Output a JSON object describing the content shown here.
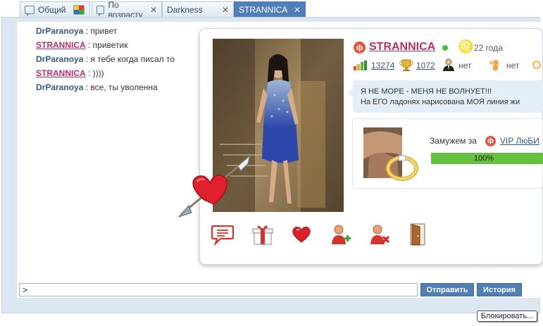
{
  "tabs": [
    {
      "label": "Общий",
      "close": ""
    },
    {
      "label": "По возрасту",
      "close": "✕"
    },
    {
      "label": "Darkness",
      "close": "✕"
    },
    {
      "label": "STRANNICA",
      "close": "✕"
    }
  ],
  "messages": [
    {
      "nick": "DrParanoya",
      "text": " : привет"
    },
    {
      "nick": "STRANNICA",
      "text": " : приветик"
    },
    {
      "nick": "DrParanoya",
      "text": " : я тебе когда писал то"
    },
    {
      "nick": "STRANNICA",
      "text": " : ))))"
    },
    {
      "nick": "DrParanoya",
      "text": " : все, ты уволенна"
    }
  ],
  "input": {
    "value": ">"
  },
  "buttons": {
    "send": "Отправить",
    "history": "История",
    "block": "Блокировать..."
  },
  "profile": {
    "name": "STRANNICA",
    "logo_letter": "ф",
    "zodiac": "♌",
    "age": "22 года",
    "rating": "13274",
    "cups": "1072",
    "status_a": "нет",
    "status_b": "нет",
    "status_text_1": "Я НЕ МОРЕ - МЕНЯ НЕ ВОЛНУЕТ!!!",
    "status_text_2": "На ЕГО ладонях нарисована МОЯ линия жи",
    "married_label": "Замужем за",
    "married_to": "VIP ЛюБИ",
    "progress_percent": 100,
    "progress_text": "100%"
  },
  "colors": {
    "accent": "#4f7fb6",
    "female_nick": "#b2326b",
    "male_nick": "#335a7e",
    "online": "#4bbf3b",
    "brand": "#e2543e"
  },
  "icons": [
    "private-message-icon",
    "gift-icon",
    "heart-icon",
    "add-friend-icon",
    "remove-friend-icon",
    "exit-door-icon"
  ]
}
